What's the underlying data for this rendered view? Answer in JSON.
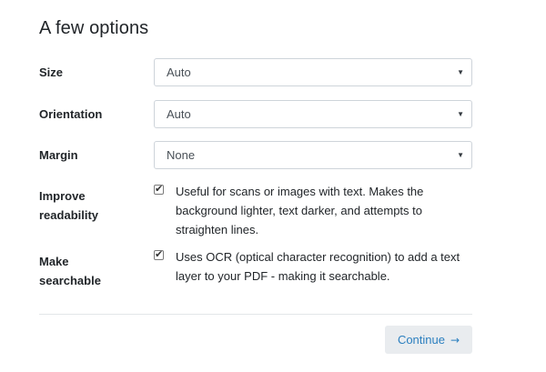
{
  "title": "A few options",
  "options": {
    "size": {
      "label": "Size",
      "value": "Auto"
    },
    "orientation": {
      "label": "Orientation",
      "value": "Auto"
    },
    "margin": {
      "label": "Margin",
      "value": "None"
    }
  },
  "checkboxes": {
    "readability": {
      "label_line1": "Improve",
      "label_line2": "readability",
      "checked": true,
      "description": "Useful for scans or images with text. Makes the background lighter, text darker, and attempts to straighten lines."
    },
    "searchable": {
      "label_line1": "Make",
      "label_line2": "searchable",
      "checked": true,
      "description": "Uses OCR (optical character recognition) to add a text layer to your PDF - making it searchable."
    }
  },
  "continue_button": {
    "label": "Continue",
    "icon": "arrow-right-icon"
  },
  "select_icon": "caret-down-icon",
  "colors": {
    "accent": "#2b7fbf",
    "button_bg": "#e9ecef",
    "border": "#ced4da"
  }
}
